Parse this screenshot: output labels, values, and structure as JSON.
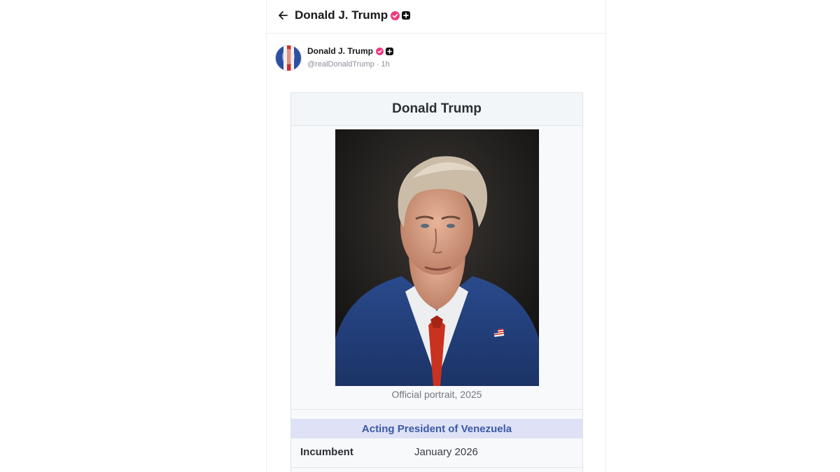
{
  "topbar": {
    "title": "Donald J. Trump",
    "back_icon": "arrow-left-icon"
  },
  "post": {
    "author_name": "Donald J. Trump",
    "author_handle": "@realDonaldTrump · 1h",
    "badges": [
      "verified-badge-icon",
      "plus-badge-icon"
    ],
    "accent_color": "#ec3a80"
  },
  "infobox": {
    "title": "Donald Trump",
    "caption": "Official portrait, 2025",
    "office": "Acting President of Venezuela",
    "row_label": "Incumbent",
    "row_value": "January 2026",
    "office_band_color": "#dfe1f6",
    "office_text_color": "#3a5aa6"
  }
}
